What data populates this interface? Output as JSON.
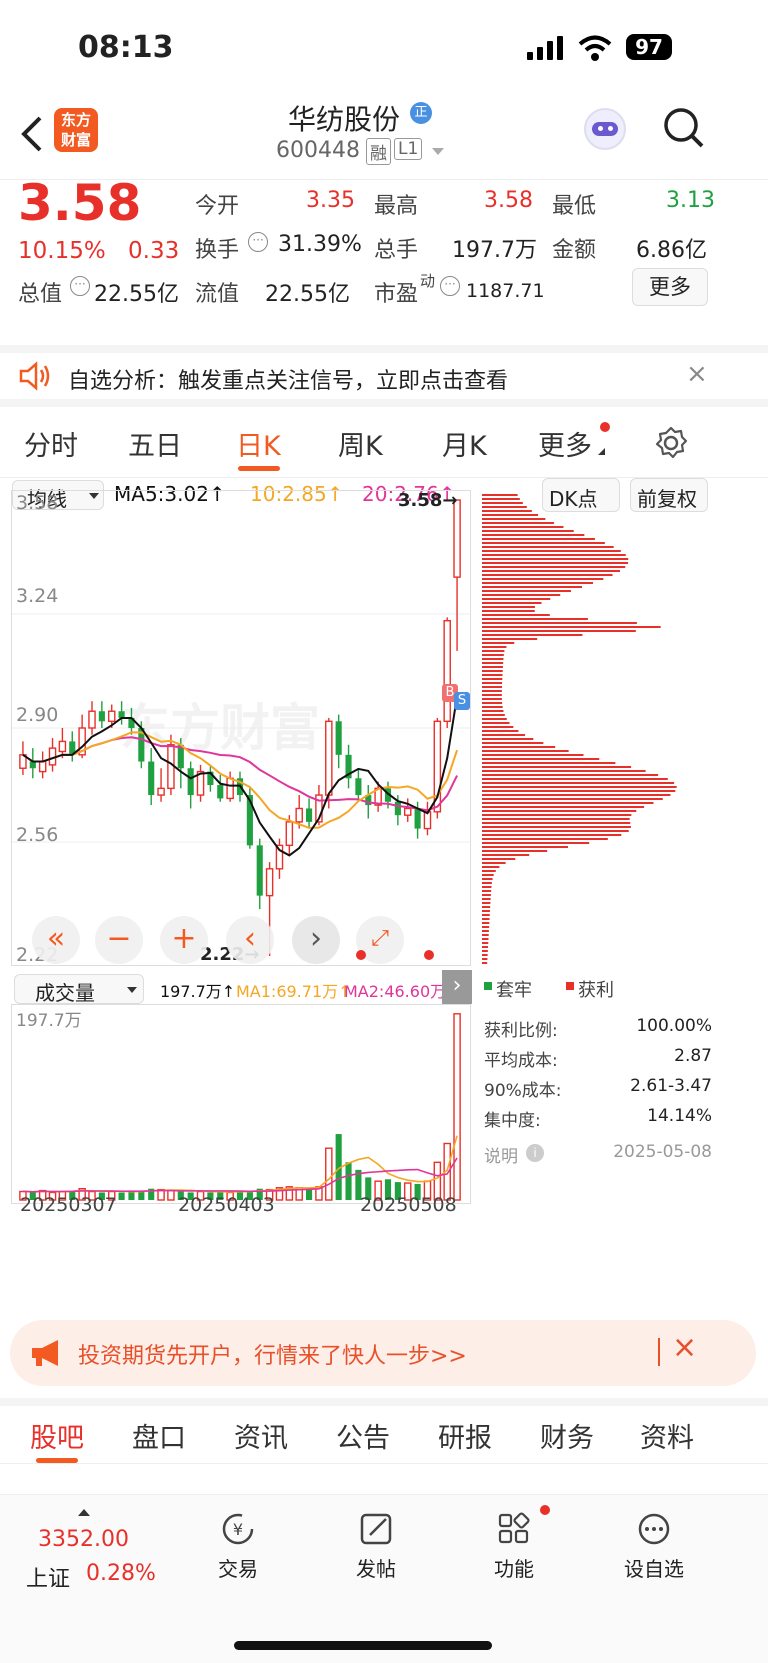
{
  "status_bar": {
    "time": "08:13",
    "battery": "97"
  },
  "header": {
    "logo_line1": "东方",
    "logo_line2": "财富",
    "stock_name": "华纺股份",
    "badge": "正",
    "code": "600448",
    "tag1": "融",
    "tag2": "L1"
  },
  "quote": {
    "price": "3.58",
    "change_pct": "10.15%",
    "change": "0.33",
    "open_label": "今开",
    "open": "3.35",
    "high_label": "最高",
    "high": "3.58",
    "low_label": "最低",
    "low": "3.13",
    "turnover_label": "换手",
    "turnover": "31.39%",
    "volume_label": "总手",
    "volume": "197.7万",
    "amount_label": "金额",
    "amount": "6.86亿",
    "mcap_label": "总值",
    "mcap": "22.55亿",
    "float_label": "流值",
    "float_val": "22.55亿",
    "pe_label": "市盈",
    "pe_sup": "动",
    "pe": "1187.71",
    "more_button": "更多"
  },
  "notice": {
    "text": "自选分析：触发重点关注信号，立即点击查看"
  },
  "ktabs": [
    "分时",
    "五日",
    "日K",
    "周K",
    "月K",
    "更多"
  ],
  "ma_bar": {
    "selector": "均线",
    "ma5": "MA5:3.02↑",
    "ma10": "10:2.85↑",
    "ma20": "20:2.76↑",
    "dk": "DK点",
    "adjust": "前复权"
  },
  "kline": {
    "y_labels": [
      "3.58",
      "3.24",
      "2.90",
      "2.56",
      "2.22"
    ],
    "high_marker": "3.58→",
    "low_marker": "2.22→",
    "watermark": "东方财富",
    "b_tag": "B",
    "s_tag": "S"
  },
  "volume_bar": {
    "selector": "成交量",
    "vol": "197.7万↑",
    "ma1": "MA1:69.71万↑",
    "ma2": "MA2:46.60万↑",
    "y_label": "197.7万"
  },
  "dates": [
    "20250307",
    "20250403",
    "20250508"
  ],
  "chip": {
    "legend_trapped": "套牢",
    "legend_profit": "获利",
    "rows": [
      {
        "label": "获利比例:",
        "value": "100.00%"
      },
      {
        "label": "平均成本:",
        "value": "2.87"
      },
      {
        "label": "90%成本:",
        "value": "2.61-3.47"
      },
      {
        "label": "集中度:",
        "value": "14.14%"
      }
    ],
    "note": "说明",
    "date": "2025-05-08"
  },
  "ad": {
    "text": "投资期货先开户，行情来了快人一步>>"
  },
  "btabs": [
    "股吧",
    "盘口",
    "资讯",
    "公告",
    "研报",
    "财务",
    "资料"
  ],
  "bottom": {
    "index_value": "3352.00",
    "index_name": "上证",
    "index_change": "0.28%",
    "nav": [
      "交易",
      "发帖",
      "功能",
      "设自选"
    ]
  },
  "colors": {
    "up": "#e8302a",
    "down": "#20a040",
    "ma5": "#111111",
    "ma10": "#f5a623",
    "ma20": "#e0359a"
  },
  "candles": [
    [
      2.78,
      2.82,
      2.86,
      2.76
    ],
    [
      2.8,
      2.78,
      2.84,
      2.75
    ],
    [
      2.77,
      2.8,
      2.83,
      2.75
    ],
    [
      2.79,
      2.84,
      2.87,
      2.77
    ],
    [
      2.83,
      2.86,
      2.9,
      2.81
    ],
    [
      2.86,
      2.82,
      2.89,
      2.8
    ],
    [
      2.82,
      2.9,
      2.94,
      2.81
    ],
    [
      2.9,
      2.95,
      2.98,
      2.88
    ],
    [
      2.95,
      2.92,
      2.98,
      2.9
    ],
    [
      2.92,
      2.95,
      2.97,
      2.9
    ],
    [
      2.95,
      2.93,
      2.98,
      2.91
    ],
    [
      2.93,
      2.9,
      2.96,
      2.88
    ],
    [
      2.9,
      2.8,
      2.92,
      2.78
    ],
    [
      2.8,
      2.7,
      2.84,
      2.67
    ],
    [
      2.7,
      2.72,
      2.78,
      2.68
    ],
    [
      2.72,
      2.85,
      2.88,
      2.7
    ],
    [
      2.85,
      2.78,
      2.87,
      2.72
    ],
    [
      2.78,
      2.7,
      2.8,
      2.66
    ],
    [
      2.7,
      2.77,
      2.79,
      2.68
    ],
    [
      2.77,
      2.73,
      2.79,
      2.71
    ],
    [
      2.73,
      2.69,
      2.76,
      2.68
    ],
    [
      2.69,
      2.75,
      2.77,
      2.68
    ],
    [
      2.75,
      2.7,
      2.77,
      2.68
    ],
    [
      2.7,
      2.55,
      2.72,
      2.54
    ],
    [
      2.55,
      2.4,
      2.57,
      2.36
    ],
    [
      2.4,
      2.48,
      2.5,
      2.22
    ],
    [
      2.48,
      2.55,
      2.57,
      2.45
    ],
    [
      2.55,
      2.62,
      2.64,
      2.52
    ],
    [
      2.62,
      2.66,
      2.7,
      2.6
    ],
    [
      2.66,
      2.62,
      2.69,
      2.6
    ],
    [
      2.62,
      2.7,
      2.73,
      2.61
    ],
    [
      2.7,
      2.92,
      2.93,
      2.66
    ],
    [
      2.92,
      2.82,
      2.94,
      2.78
    ],
    [
      2.82,
      2.75,
      2.85,
      2.72
    ],
    [
      2.75,
      2.7,
      2.78,
      2.68
    ],
    [
      2.7,
      2.67,
      2.73,
      2.63
    ],
    [
      2.67,
      2.72,
      2.74,
      2.65
    ],
    [
      2.72,
      2.68,
      2.74,
      2.66
    ],
    [
      2.68,
      2.64,
      2.7,
      2.61
    ],
    [
      2.64,
      2.66,
      2.69,
      2.62
    ],
    [
      2.66,
      2.6,
      2.68,
      2.57
    ],
    [
      2.6,
      2.65,
      2.68,
      2.58
    ],
    [
      2.65,
      2.92,
      2.93,
      2.63
    ],
    [
      2.92,
      3.22,
      3.23,
      2.9
    ],
    [
      3.35,
      3.58,
      3.58,
      3.13
    ]
  ],
  "volumes": [
    9,
    8,
    10,
    8,
    9,
    10,
    12,
    9,
    8,
    9,
    8,
    9,
    10,
    12,
    11,
    10,
    9,
    8,
    9,
    8,
    9,
    8,
    9,
    10,
    12,
    11,
    13,
    14,
    13,
    12,
    14,
    55,
    70,
    40,
    32,
    24,
    20,
    22,
    19,
    18,
    17,
    20,
    40,
    60,
    197.7
  ]
}
